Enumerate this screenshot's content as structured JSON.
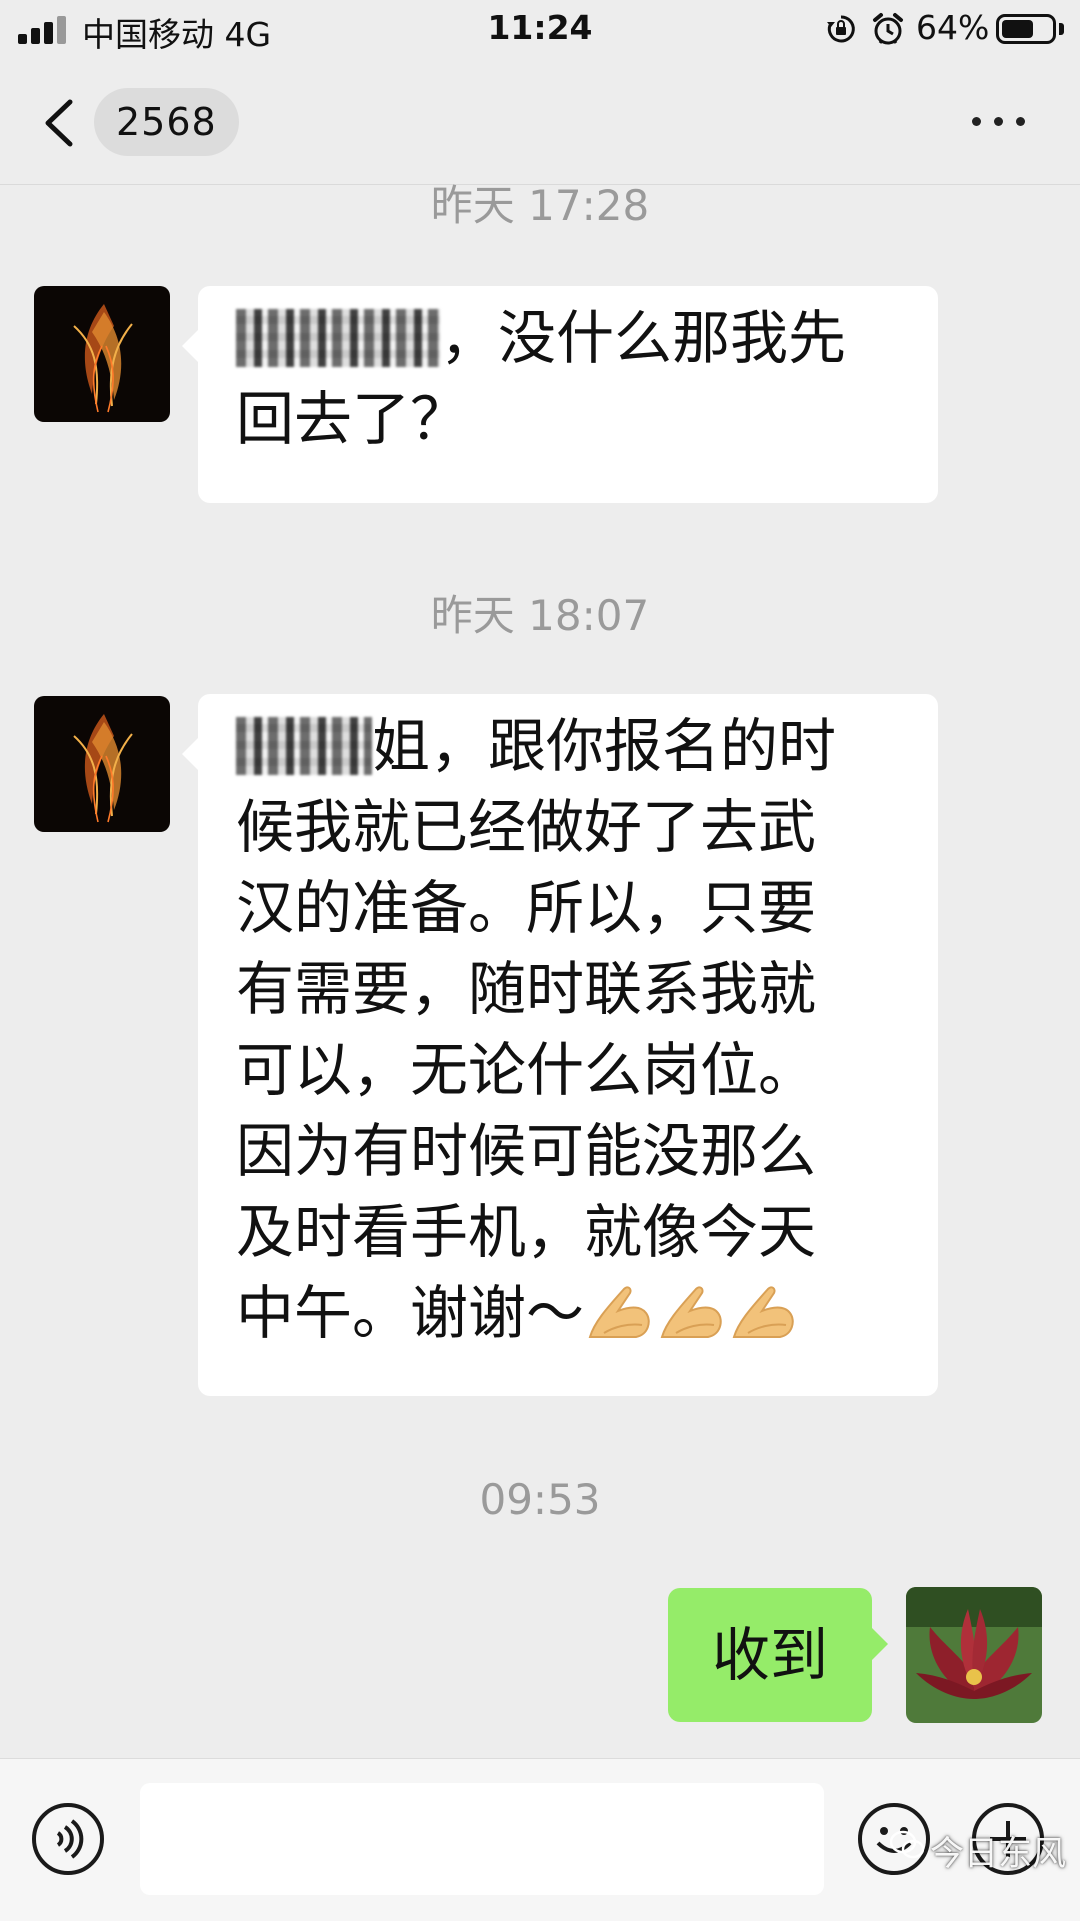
{
  "status_bar": {
    "carrier": "中国移动  4G",
    "time": "11:24",
    "battery_percent": "64%",
    "battery_level": 0.64,
    "icons": [
      "signal-icon",
      "rotation-lock-icon",
      "alarm-icon",
      "battery-icon"
    ]
  },
  "nav": {
    "unread_count": "2568",
    "title": "",
    "icons": [
      "back-chevron-icon",
      "more-dots-icon"
    ]
  },
  "messages": [
    {
      "type": "timestamp",
      "text": "昨天 17:28"
    },
    {
      "type": "incoming",
      "avatar": "phoenix-avatar",
      "lines": [
        {
          "redacted": true,
          "after": "，没什么那我先"
        },
        {
          "text": "回去了？"
        }
      ]
    },
    {
      "type": "timestamp",
      "text": "昨天 18:07"
    },
    {
      "type": "incoming",
      "avatar": "phoenix-avatar",
      "lines": [
        {
          "redacted": true,
          "after": "姐，跟你报名的时"
        },
        {
          "text": "候我就已经做好了去武"
        },
        {
          "text": "汉的准备。所以，只要"
        },
        {
          "text": "有需要，随时联系我就"
        },
        {
          "text": "可以，无论什么岗位。"
        },
        {
          "text": "因为有时候可能没那么"
        },
        {
          "text": "及时看手机，就像今天"
        },
        {
          "text": "中午。谢谢～",
          "emoji": [
            "folded-hands-emoji",
            "folded-hands-emoji",
            "folded-hands-emoji"
          ]
        }
      ]
    },
    {
      "type": "timestamp",
      "text": "09:53"
    },
    {
      "type": "outgoing",
      "avatar": "flower-avatar",
      "text": "收到"
    }
  ],
  "input_bar": {
    "placeholder": "",
    "icons": [
      "voice-icon",
      "emoji-icon",
      "plus-icon"
    ]
  },
  "watermark": {
    "text": "今日东风",
    "icon": "wechat-icon"
  },
  "colors": {
    "background": "#ededed",
    "incoming_bubble": "#ffffff",
    "outgoing_bubble": "#95ec69",
    "timestamp": "#9a9a9a"
  }
}
